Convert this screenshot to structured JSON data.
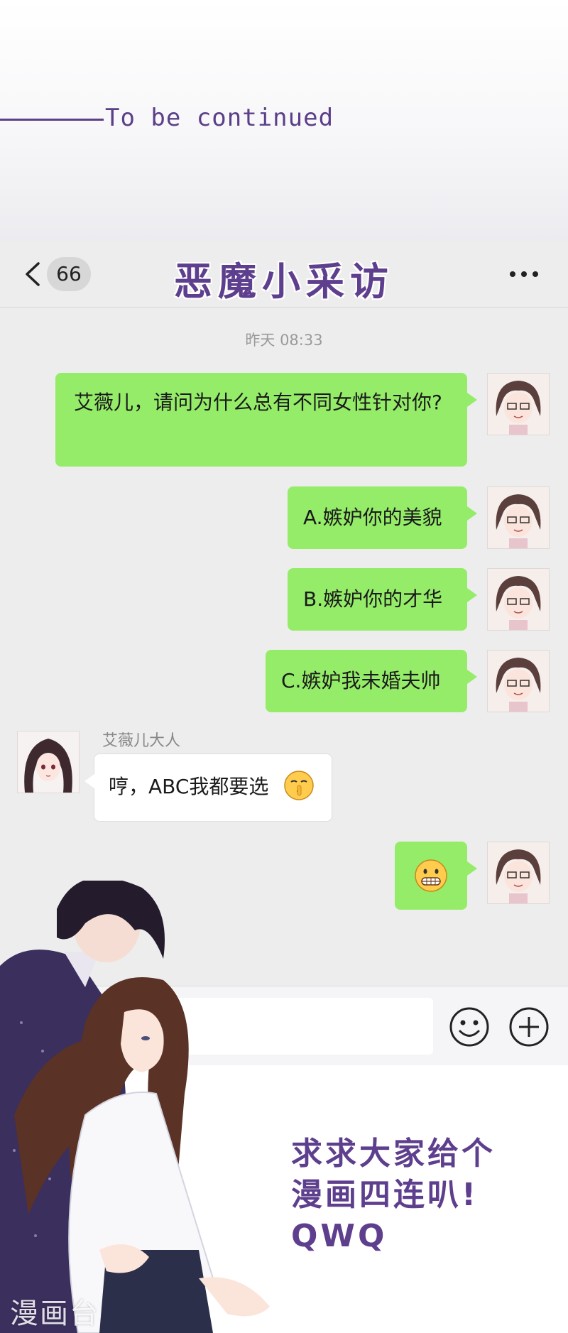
{
  "top": {
    "tbc_text": "To be continued"
  },
  "header": {
    "unread_count": "66",
    "title": "恶魔小采访"
  },
  "chat": {
    "timestamp": "昨天 08:33",
    "messages": [
      {
        "side": "right",
        "text": "艾薇儿，请问为什么总有不同女性针对你?"
      },
      {
        "side": "right",
        "text": "A.嫉妒你的美貌"
      },
      {
        "side": "right",
        "text": "B.嫉妒你的才华"
      },
      {
        "side": "right",
        "text": "C.嫉妒我未婚夫帅"
      },
      {
        "side": "left",
        "sender": "艾薇儿大人",
        "text": "哼，ABC我都要选"
      },
      {
        "side": "right",
        "text": ""
      }
    ]
  },
  "bottom": {
    "plea_lines": [
      "求求大家给个",
      "漫画四连叭!",
      "QWQ"
    ],
    "watermark": "漫画台"
  },
  "icons": [
    "back-icon",
    "more-icon",
    "emoji-icon",
    "plus-icon",
    "shush-face-emoji",
    "grin-face-emoji"
  ],
  "colors": {
    "accent_purple": "#5e3f8e",
    "bubble_green": "#95ec69",
    "chat_bg": "#ededed"
  }
}
